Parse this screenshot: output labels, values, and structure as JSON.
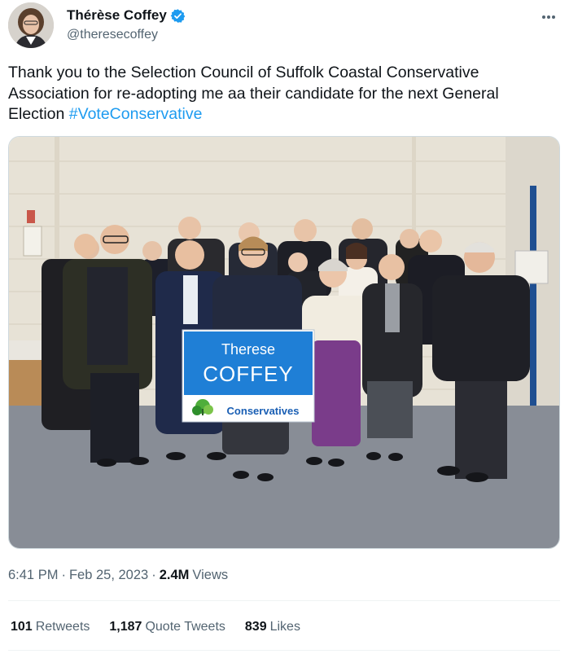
{
  "author": {
    "display_name": "Thérèse Coffey",
    "handle": "@theresecoffey",
    "verified": true,
    "verified_color": "#1d9bf0"
  },
  "tweet": {
    "text_before_hashtag": "Thank you to the Selection Council of Suffolk Coastal Conservative Association for re-adopting me aa their candidate for the next General Election ",
    "hashtag": "#VoteConservative"
  },
  "photo": {
    "sign_line1": "Therese",
    "sign_line2": "COFFEY",
    "sign_party": "Conservatives"
  },
  "meta": {
    "time": "6:41 PM",
    "separator1": "·",
    "date": "Feb 25, 2023",
    "separator2": "·",
    "views_count": "2.4M",
    "views_label": "Views"
  },
  "stats": {
    "retweets_count": "101",
    "retweets_label": "Retweets",
    "quotes_count": "1,187",
    "quotes_label": "Quote Tweets",
    "likes_count": "839",
    "likes_label": "Likes"
  },
  "colors": {
    "accent": "#1d9bf0",
    "text_primary": "#0f1419",
    "text_secondary": "#536471"
  },
  "icons": [
    "avatar",
    "verified-badge-icon",
    "more-options-icon",
    "oak-tree-logo-icon"
  ]
}
